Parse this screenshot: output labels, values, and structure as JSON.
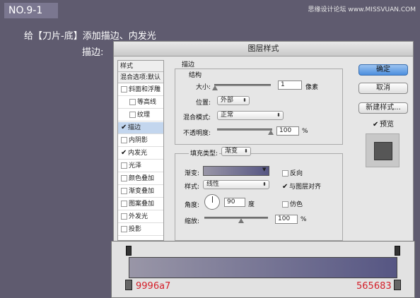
{
  "header": {
    "step": "NO.9-1",
    "watermark": "思缘设计论坛 www.MISSVUAN.COM",
    "instruction": "给【刀片-底】添加描边、内发光",
    "sub_instruction": "描边:"
  },
  "dialog": {
    "title": "图层样式",
    "sidebar": {
      "header": "样式",
      "blend_default": "混合选项:默认",
      "items": [
        {
          "label": "斜面和浮雕",
          "checked": false,
          "indent": false,
          "active": false
        },
        {
          "label": "等高线",
          "checked": false,
          "indent": true,
          "active": false
        },
        {
          "label": "纹理",
          "checked": false,
          "indent": true,
          "active": false
        },
        {
          "label": "描边",
          "checked": true,
          "indent": false,
          "active": true
        },
        {
          "label": "内阴影",
          "checked": false,
          "indent": false,
          "active": false
        },
        {
          "label": "内发光",
          "checked": true,
          "indent": false,
          "active": false
        },
        {
          "label": "光泽",
          "checked": false,
          "indent": false,
          "active": false
        },
        {
          "label": "颜色叠加",
          "checked": false,
          "indent": false,
          "active": false
        },
        {
          "label": "渐变叠加",
          "checked": false,
          "indent": false,
          "active": false
        },
        {
          "label": "图案叠加",
          "checked": false,
          "indent": false,
          "active": false
        },
        {
          "label": "外发光",
          "checked": false,
          "indent": false,
          "active": false
        },
        {
          "label": "投影",
          "checked": false,
          "indent": false,
          "active": false
        }
      ]
    },
    "stroke": {
      "section_title": "描边",
      "structure_title": "结构",
      "size_label": "大小:",
      "size_value": "1",
      "size_unit": "像素",
      "position_label": "位置:",
      "position_value": "外部",
      "blend_label": "混合模式:",
      "blend_value": "正常",
      "opacity_label": "不透明度:",
      "opacity_value": "100",
      "opacity_unit": "%",
      "fill_type_label": "填充类型:",
      "fill_type_value": "渐变",
      "gradient_label": "渐变:",
      "reverse_label": "反向",
      "reverse_checked": false,
      "style_label": "样式:",
      "style_value": "线性",
      "align_label": "与图层对齐",
      "align_checked": true,
      "angle_label": "角度:",
      "angle_value": "90",
      "angle_unit": "度",
      "dither_label": "仿色",
      "dither_checked": false,
      "scale_label": "缩放:",
      "scale_value": "100",
      "scale_unit": "%"
    },
    "buttons": {
      "ok": "确定",
      "cancel": "取消",
      "new_style": "新建样式...",
      "preview_label": "预览",
      "preview_checked": true
    }
  },
  "gradient_editor": {
    "left_color": "9996a7",
    "right_color": "565683"
  },
  "icons": {
    "check": "check-icon",
    "dropdown": "chevron-down-icon"
  }
}
